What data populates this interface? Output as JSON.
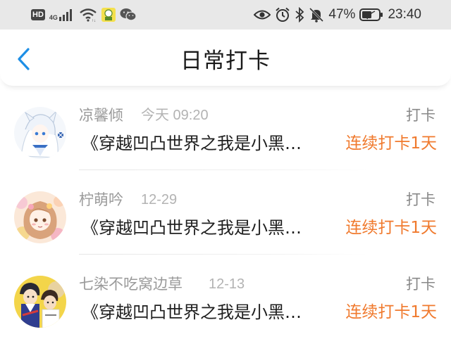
{
  "status_bar": {
    "hd_label": "HD",
    "network_type": "4G",
    "battery_percent": "47%",
    "time": "23:40",
    "left_icons": [
      "hd-icon",
      "signal-4g-icon",
      "wifi-icon",
      "app-notification-icon",
      "wechat-icon"
    ],
    "right_icons": [
      "eye-icon",
      "alarm-icon",
      "bluetooth-icon",
      "mute-icon",
      "battery-icon"
    ]
  },
  "header": {
    "title": "日常打卡",
    "back_icon": "chevron-left-icon",
    "accent_color": "#1e8fe6"
  },
  "feed": {
    "items": [
      {
        "user": "凉馨倾",
        "time": "今天 09:20",
        "action": "打卡",
        "book": "《穿越凹凸世界之我是小黑…",
        "streak": "连续打卡1天",
        "avatar": "anime-avatar-white-hair"
      },
      {
        "user": "柠萌吟",
        "time": "12-29",
        "action": "打卡",
        "book": "《穿越凹凸世界之我是小黑…",
        "streak": "连续打卡1天",
        "avatar": "anime-avatar-flower-girl"
      },
      {
        "user": "七染不吃窝边草",
        "time": "12-13",
        "action": "打卡",
        "book": "《穿越凹凸世界之我是小黑…",
        "streak": "连续打卡1天",
        "avatar": "anime-avatar-two-boys"
      }
    ],
    "streak_color": "#f07a2e"
  }
}
